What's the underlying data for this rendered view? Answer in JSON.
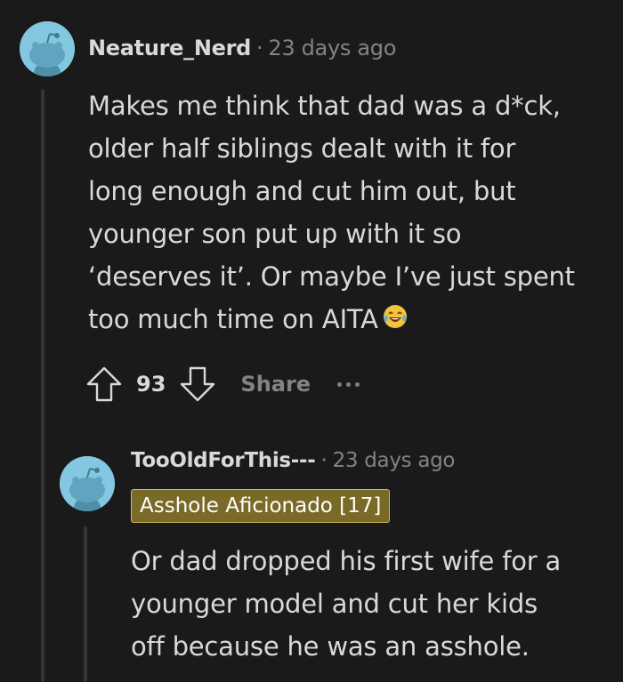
{
  "comments": [
    {
      "username": "Neature_Nerd",
      "separator": "·",
      "time": "23 days ago",
      "body_lines": [
        "Makes me think that dad was a d*ck,",
        "older half siblings dealt with it for",
        "long enough and cut him out, but",
        "younger son put up with it so",
        "‘deserves it’. Or maybe I’ve just spent",
        "too much time on AITA"
      ],
      "emoji": "face-with-tears-of-joy-icon",
      "votes": "93",
      "share_label": "Share"
    },
    {
      "username": "TooOldForThis---",
      "separator": "·",
      "time": "23 days ago",
      "flair": "Asshole Aficionado [17]",
      "body_lines": [
        "Or dad dropped his first wife for a",
        "younger model and cut her kids",
        "off because he was an asshole."
      ]
    }
  ],
  "colors": {
    "background": "#1a1a1b",
    "text": "#d7dadc",
    "muted": "#818384",
    "avatar_bg": "#84c7e0",
    "flair_bg": "#7a6a28",
    "flair_border": "#d1b756"
  }
}
